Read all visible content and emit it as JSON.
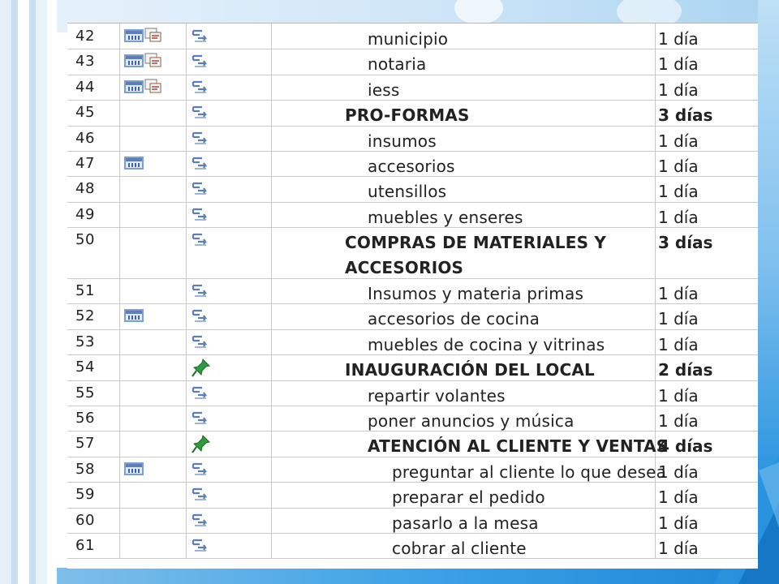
{
  "colors": {
    "stripe_light": "#dcebf7",
    "stripe_mid": "#b9d6ee",
    "accent_blue": "#1c86d6",
    "grid": "#c9c9c9",
    "text": "#222222"
  },
  "rows": [
    {
      "id": "42",
      "name": "municipio",
      "duration": "1 día",
      "summary": false,
      "level": 1,
      "indicators": [
        "calendar-icon",
        "note-icon"
      ],
      "mode": "auto-scheduled-icon"
    },
    {
      "id": "43",
      "name": "notaria",
      "duration": "1 día",
      "summary": false,
      "level": 1,
      "indicators": [
        "calendar-icon",
        "note-icon"
      ],
      "mode": "auto-scheduled-icon"
    },
    {
      "id": "44",
      "name": "iess",
      "duration": "1 día",
      "summary": false,
      "level": 1,
      "indicators": [
        "calendar-icon",
        "note-icon"
      ],
      "mode": "auto-scheduled-icon"
    },
    {
      "id": "45",
      "name": "PRO-FORMAS",
      "duration": "3 días",
      "summary": true,
      "level": 0,
      "indicators": [],
      "mode": "auto-scheduled-icon"
    },
    {
      "id": "46",
      "name": "insumos",
      "duration": "1 día",
      "summary": false,
      "level": 1,
      "indicators": [],
      "mode": "auto-scheduled-icon"
    },
    {
      "id": "47",
      "name": "accesorios",
      "duration": "1 día",
      "summary": false,
      "level": 1,
      "indicators": [
        "calendar-icon"
      ],
      "mode": "auto-scheduled-icon"
    },
    {
      "id": "48",
      "name": "utensillos",
      "duration": "1 día",
      "summary": false,
      "level": 1,
      "indicators": [],
      "mode": "auto-scheduled-icon"
    },
    {
      "id": "49",
      "name": "muebles y enseres",
      "duration": "1 día",
      "summary": false,
      "level": 1,
      "indicators": [],
      "mode": "auto-scheduled-icon"
    },
    {
      "id": "50",
      "name": "COMPRAS DE MATERIALES  Y ACCESORIOS",
      "duration": "3 días",
      "summary": true,
      "level": 0,
      "indicators": [],
      "mode": "auto-scheduled-icon",
      "tall": true
    },
    {
      "id": "51",
      "name": "Insumos y materia primas",
      "duration": "1 día",
      "summary": false,
      "level": 1,
      "indicators": [],
      "mode": "auto-scheduled-icon"
    },
    {
      "id": "52",
      "name": "accesorios de cocina",
      "duration": "1 día",
      "summary": false,
      "level": 1,
      "indicators": [
        "calendar-icon"
      ],
      "mode": "auto-scheduled-icon"
    },
    {
      "id": "53",
      "name": "muebles de cocina y vitrinas",
      "duration": "1 día",
      "summary": false,
      "level": 1,
      "indicators": [],
      "mode": "auto-scheduled-icon"
    },
    {
      "id": "54",
      "name": "INAUGURACIÓN DEL LOCAL",
      "duration": "2 días",
      "summary": true,
      "level": 0,
      "indicators": [],
      "mode": "manual-pin-icon"
    },
    {
      "id": "55",
      "name": "repartir volantes",
      "duration": "1 día",
      "summary": false,
      "level": 1,
      "indicators": [],
      "mode": "auto-scheduled-icon"
    },
    {
      "id": "56",
      "name": "poner anuncios y música",
      "duration": "1 día",
      "summary": false,
      "level": 1,
      "indicators": [],
      "mode": "auto-scheduled-icon"
    },
    {
      "id": "57",
      "name": "ATENCIÓN AL CLIENTE Y VENTAS",
      "duration": "4 días",
      "summary": true,
      "level": 1,
      "indicators": [],
      "mode": "manual-pin-icon"
    },
    {
      "id": "58",
      "name": "preguntar al cliente lo que desea",
      "duration": "1 día",
      "summary": false,
      "level": 2,
      "indicators": [
        "calendar-icon"
      ],
      "mode": "auto-scheduled-icon"
    },
    {
      "id": "59",
      "name": "preparar el pedido",
      "duration": "1 día",
      "summary": false,
      "level": 2,
      "indicators": [],
      "mode": "auto-scheduled-icon"
    },
    {
      "id": "60",
      "name": "pasarlo a la mesa",
      "duration": "1 día",
      "summary": false,
      "level": 2,
      "indicators": [],
      "mode": "auto-scheduled-icon"
    },
    {
      "id": "61",
      "name": "cobrar al cliente",
      "duration": "1 día",
      "summary": false,
      "level": 2,
      "indicators": [],
      "mode": "auto-scheduled-icon"
    }
  ]
}
